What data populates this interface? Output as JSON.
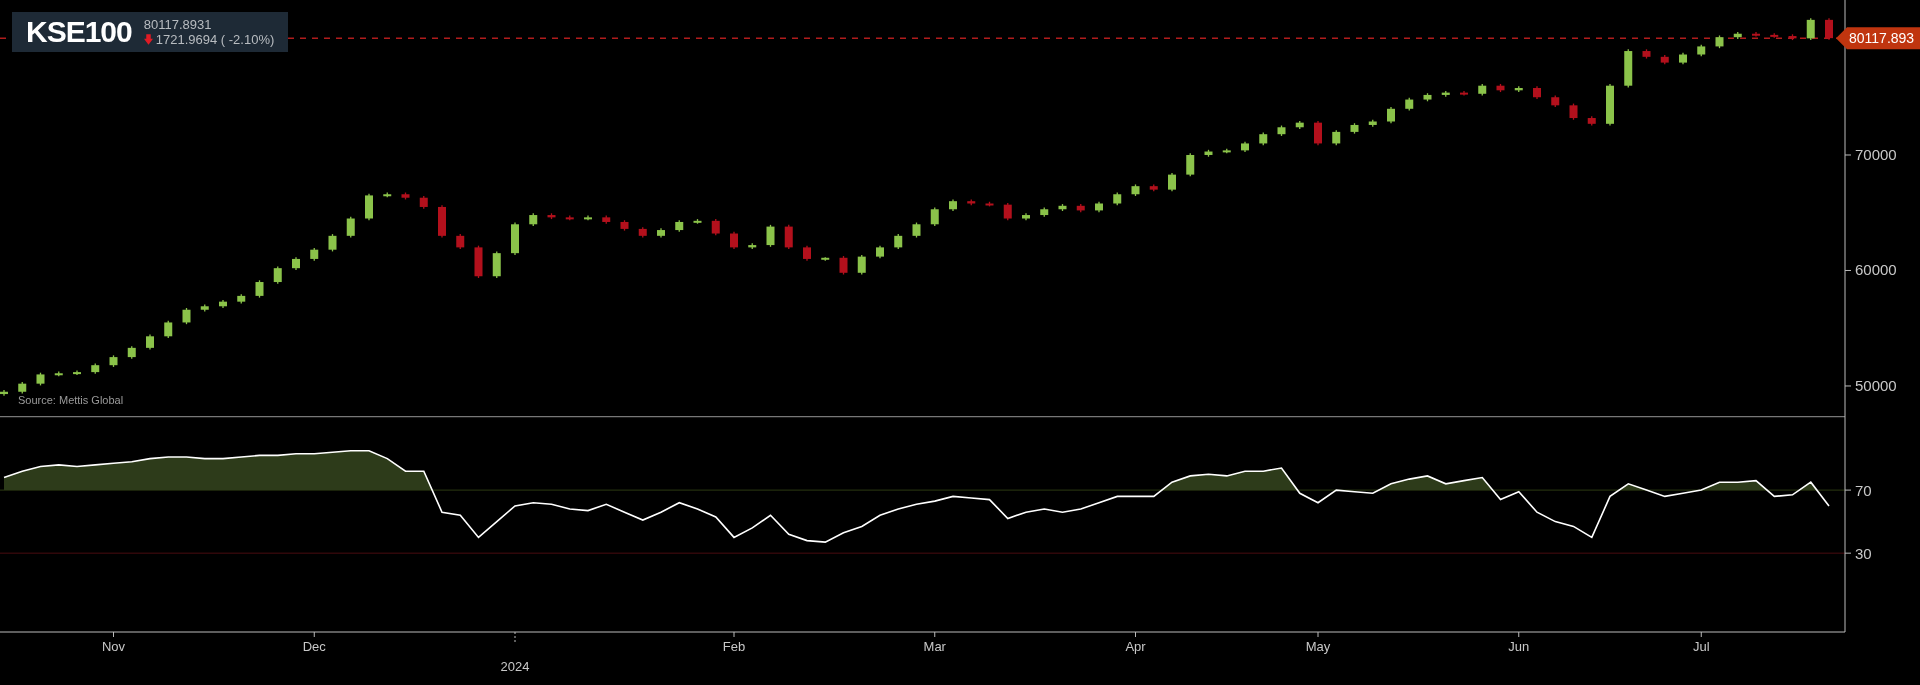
{
  "header": {
    "symbol": "KSE100",
    "price": "80117.8931",
    "change": "1721.9694 ( -2.10%)",
    "down": true
  },
  "source": "Source: Mettis Global",
  "price_chart": {
    "price_tag": "80117.893",
    "chart_data": {
      "type": "candlestick",
      "categories": [
        null,
        null,
        null,
        null,
        null,
        null,
        null,
        null,
        null,
        null,
        null,
        null,
        null,
        null,
        null,
        null,
        null,
        null,
        null,
        null,
        null,
        null,
        null,
        null,
        null,
        null,
        null,
        null,
        null,
        null,
        null,
        null,
        null,
        null,
        null,
        null,
        null,
        null,
        null,
        null,
        null,
        null,
        null,
        null,
        null,
        null,
        null,
        null,
        null,
        null,
        null,
        null,
        null,
        null,
        null,
        null,
        null,
        null,
        null,
        null,
        null,
        null,
        null,
        null,
        null,
        null,
        null,
        null,
        null,
        null,
        null,
        null,
        null,
        null,
        null,
        null,
        null,
        null,
        null,
        null,
        null,
        null,
        null,
        null,
        null,
        null,
        null,
        null,
        null,
        null,
        null,
        null,
        null,
        null,
        null,
        null,
        null,
        null,
        null,
        null,
        null
      ],
      "ylim": [
        47400,
        83420
      ],
      "yticks": [
        50000,
        60000,
        70000
      ],
      "ohlc": [
        [
          49300,
          49650,
          49150,
          49500
        ],
        [
          49500,
          50350,
          49350,
          50200
        ],
        [
          50200,
          51150,
          50050,
          51000
        ],
        [
          51000,
          51250,
          50850,
          51100
        ],
        [
          51100,
          51350,
          50950,
          51200
        ],
        [
          51200,
          51950,
          51050,
          51800
        ],
        [
          51800,
          52650,
          51650,
          52500
        ],
        [
          52500,
          53450,
          52350,
          53300
        ],
        [
          53300,
          54450,
          53150,
          54300
        ],
        [
          54300,
          55650,
          54150,
          55500
        ],
        [
          55500,
          56750,
          55350,
          56600
        ],
        [
          56600,
          57050,
          56450,
          56900
        ],
        [
          56900,
          57450,
          56750,
          57300
        ],
        [
          57300,
          57950,
          57150,
          57800
        ],
        [
          57800,
          59150,
          57650,
          59000
        ],
        [
          59000,
          60350,
          58850,
          60200
        ],
        [
          60200,
          61150,
          60050,
          61000
        ],
        [
          61000,
          61950,
          60850,
          61800
        ],
        [
          61800,
          63150,
          61650,
          63000
        ],
        [
          63000,
          64650,
          62850,
          64500
        ],
        [
          64500,
          66650,
          64350,
          66500
        ],
        [
          66500,
          66750,
          66350,
          66600
        ],
        [
          66600,
          66750,
          66150,
          66300
        ],
        [
          66300,
          66450,
          65350,
          65500
        ],
        [
          65500,
          65650,
          62850,
          63000
        ],
        [
          63000,
          63150,
          61850,
          62000
        ],
        [
          62000,
          62150,
          59350,
          59500
        ],
        [
          59500,
          61650,
          59350,
          61500
        ],
        [
          61500,
          64150,
          61350,
          64000
        ],
        [
          64000,
          64950,
          63850,
          64800
        ],
        [
          64800,
          64950,
          64450,
          64600
        ],
        [
          64600,
          64750,
          64350,
          64500
        ],
        [
          64500,
          64750,
          64350,
          64600
        ],
        [
          64600,
          64750,
          64050,
          64200
        ],
        [
          64200,
          64350,
          63450,
          63600
        ],
        [
          63600,
          63750,
          62850,
          63000
        ],
        [
          63000,
          63650,
          62850,
          63500
        ],
        [
          63500,
          64350,
          63350,
          64200
        ],
        [
          64200,
          64450,
          64050,
          64300
        ],
        [
          64300,
          64450,
          63050,
          63200
        ],
        [
          63200,
          63350,
          61850,
          62000
        ],
        [
          62000,
          62350,
          61850,
          62200
        ],
        [
          62200,
          63950,
          62050,
          63800
        ],
        [
          63800,
          63950,
          61850,
          62000
        ],
        [
          62000,
          62150,
          60850,
          61000
        ],
        [
          61000,
          61150,
          60850,
          61100
        ],
        [
          61100,
          61250,
          59650,
          59800
        ],
        [
          59800,
          61350,
          59650,
          61200
        ],
        [
          61200,
          62150,
          61050,
          62000
        ],
        [
          62000,
          63150,
          61850,
          63000
        ],
        [
          63000,
          64150,
          62850,
          64000
        ],
        [
          64000,
          65450,
          63850,
          65300
        ],
        [
          65300,
          66150,
          65150,
          66000
        ],
        [
          66000,
          66150,
          65650,
          65800
        ],
        [
          65800,
          65950,
          65550,
          65700
        ],
        [
          65700,
          65850,
          64350,
          64500
        ],
        [
          64500,
          64950,
          64350,
          64800
        ],
        [
          64800,
          65450,
          64650,
          65300
        ],
        [
          65300,
          65750,
          65150,
          65600
        ],
        [
          65600,
          65750,
          65050,
          65200
        ],
        [
          65200,
          65950,
          65050,
          65800
        ],
        [
          65800,
          66750,
          65650,
          66600
        ],
        [
          66600,
          67450,
          66450,
          67300
        ],
        [
          67300,
          67450,
          66850,
          67000
        ],
        [
          67000,
          68450,
          66850,
          68300
        ],
        [
          68300,
          70150,
          68150,
          70000
        ],
        [
          70000,
          70450,
          69850,
          70300
        ],
        [
          70300,
          70550,
          70150,
          70400
        ],
        [
          70400,
          71150,
          70250,
          71000
        ],
        [
          71000,
          71950,
          70850,
          71800
        ],
        [
          71800,
          72550,
          71650,
          72400
        ],
        [
          72400,
          72950,
          72250,
          72800
        ],
        [
          72800,
          72950,
          70850,
          71000
        ],
        [
          71000,
          72150,
          70850,
          72000
        ],
        [
          72000,
          72750,
          71850,
          72600
        ],
        [
          72600,
          73050,
          72450,
          72900
        ],
        [
          72900,
          74150,
          72750,
          74000
        ],
        [
          74000,
          74950,
          73850,
          74800
        ],
        [
          74800,
          75350,
          74650,
          75200
        ],
        [
          75200,
          75550,
          75050,
          75400
        ],
        [
          75400,
          75550,
          75150,
          75300
        ],
        [
          75300,
          76150,
          75150,
          76000
        ],
        [
          76000,
          76150,
          75450,
          75600
        ],
        [
          75600,
          75950,
          75450,
          75800
        ],
        [
          75800,
          75950,
          74850,
          75000
        ],
        [
          75000,
          75150,
          74150,
          74300
        ],
        [
          74300,
          74450,
          73050,
          73200
        ],
        [
          73200,
          73350,
          72550,
          72700
        ],
        [
          72700,
          76150,
          72550,
          76000
        ],
        [
          76000,
          79150,
          75850,
          79000
        ],
        [
          79000,
          79150,
          78350,
          78500
        ],
        [
          78500,
          78650,
          77850,
          78000
        ],
        [
          78000,
          78850,
          77850,
          78700
        ],
        [
          78700,
          79550,
          78550,
          79400
        ],
        [
          79400,
          80350,
          79250,
          80200
        ],
        [
          80200,
          80650,
          80050,
          80500
        ],
        [
          80500,
          80650,
          80250,
          80400
        ],
        [
          80400,
          80550,
          80150,
          80300
        ],
        [
          80300,
          80450,
          79950,
          80100
        ],
        [
          80100,
          81850,
          79950,
          81700
        ],
        [
          81700,
          81850,
          79968,
          80117.8931
        ]
      ]
    }
  },
  "rsi_chart": {
    "chart_data": {
      "type": "line",
      "ylim": [
        -20,
        117
      ],
      "yticks": [
        70,
        30
      ],
      "categories": [
        null,
        null,
        null,
        null,
        null,
        null,
        "Nov",
        null,
        null,
        null,
        null,
        null,
        null,
        null,
        null,
        null,
        null,
        "Dec",
        null,
        null,
        null,
        null,
        null,
        null,
        null,
        null,
        null,
        null,
        "2024",
        null,
        null,
        null,
        null,
        null,
        null,
        null,
        null,
        null,
        null,
        null,
        "Feb",
        null,
        null,
        null,
        null,
        null,
        null,
        null,
        null,
        null,
        null,
        "Mar",
        null,
        null,
        null,
        null,
        null,
        null,
        null,
        null,
        null,
        null,
        "Apr",
        null,
        null,
        null,
        null,
        null,
        null,
        null,
        null,
        null,
        "May",
        null,
        null,
        null,
        null,
        null,
        null,
        null,
        null,
        null,
        null,
        "Jun",
        null,
        null,
        null,
        null,
        null,
        null,
        null,
        null,
        null,
        "Jul",
        null,
        null,
        null,
        null,
        null,
        null,
        null
      ],
      "series": [
        {
          "color": "#ffffff",
          "values": [
            78,
            82,
            85,
            86,
            85,
            86,
            87,
            88,
            90,
            91,
            91,
            90,
            90,
            91,
            92,
            92,
            93,
            93,
            94,
            95,
            95,
            90,
            82,
            82,
            56,
            54,
            40,
            50,
            60,
            62,
            61,
            58,
            57,
            61,
            56,
            51,
            56,
            62,
            58,
            53,
            40,
            46,
            54,
            42,
            38,
            37,
            43,
            47,
            54,
            58,
            61,
            63,
            66,
            65,
            64,
            52,
            56,
            58,
            56,
            58,
            62,
            66,
            66,
            66,
            75,
            79,
            80,
            79,
            82,
            82,
            84,
            68,
            62,
            70,
            69,
            68,
            74,
            77,
            79,
            74,
            76,
            78,
            64,
            69,
            56,
            50,
            47,
            40,
            66,
            74,
            70,
            66,
            68,
            70,
            75,
            75,
            76,
            66,
            67,
            75,
            60
          ]
        }
      ]
    }
  }
}
